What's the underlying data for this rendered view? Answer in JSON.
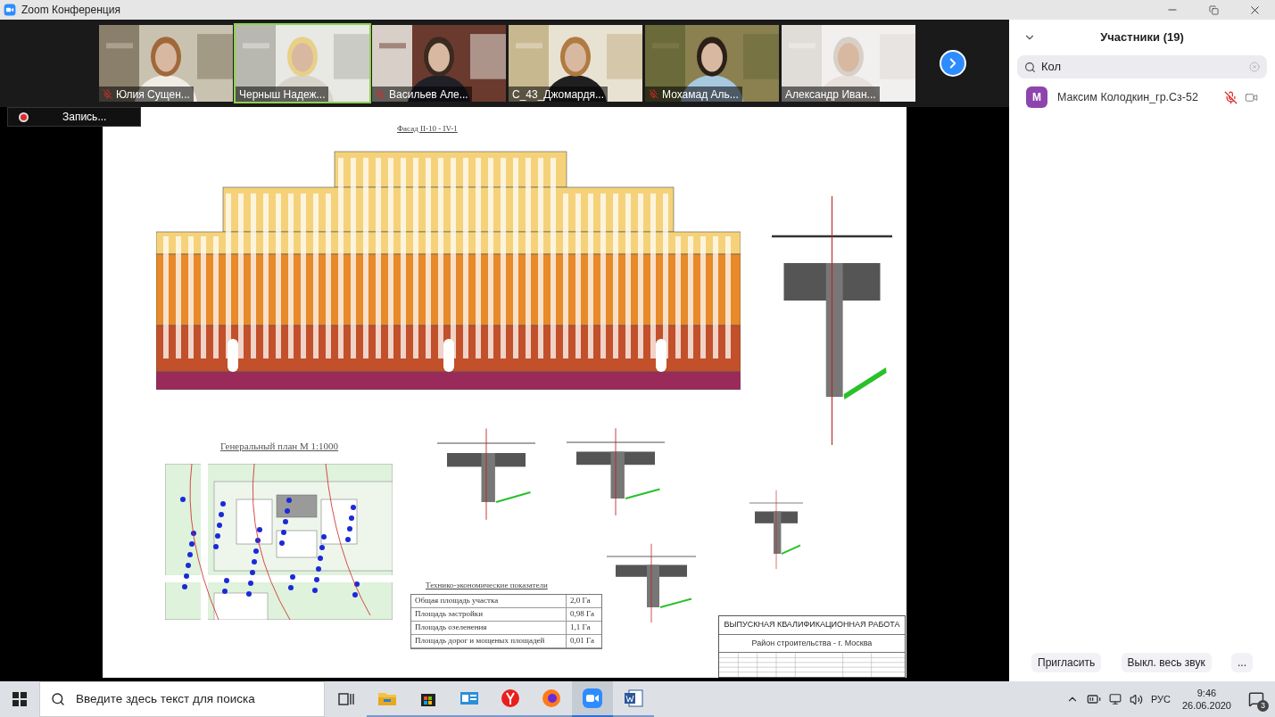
{
  "window": {
    "title": "Zoom Конференция"
  },
  "video_strip": {
    "tiles": [
      {
        "name": "Юлия Сущен...",
        "muted": true,
        "active_speaker": false
      },
      {
        "name": "Черныш Надеж...",
        "muted": false,
        "active_speaker": true
      },
      {
        "name": "Васильев Але...",
        "muted": true,
        "active_speaker": false
      },
      {
        "name": "С_43_Джомардя...",
        "muted": false,
        "active_speaker": false
      },
      {
        "name": "Мохамад Аль...",
        "muted": true,
        "active_speaker": false
      },
      {
        "name": "Александр Иван...",
        "muted": false,
        "active_speaker": false
      }
    ]
  },
  "recording": {
    "label": "Запись..."
  },
  "shared_sheet": {
    "facade_title": "Фасад II-10 - IV-1",
    "plan_title": "Генеральный план М 1:1000",
    "table_title": "Технико-экономические показатели",
    "table_rows": [
      {
        "label": "Общая площадь участка",
        "value": "2,0 Га"
      },
      {
        "label": "Площадь застройки",
        "value": "0,98 Га"
      },
      {
        "label": "Площадь озеленения",
        "value": "1,1 Га"
      },
      {
        "label": "Площадь дорог и мощеных площадей",
        "value": "0,01 Га"
      }
    ],
    "title_block": {
      "heading": "ВЫПУСКНАЯ КВАЛИФИКАЦИОННАЯ РАБОТА",
      "subheading": "Район строительства - г. Москва"
    }
  },
  "participants_panel": {
    "title": "Участники (19)",
    "search": {
      "value": "Кол"
    },
    "participants": [
      {
        "initial": "M",
        "name": "Максим Колодкин_гр.Сз-52",
        "color": "#8e44ad",
        "muted": true
      }
    ],
    "buttons": [
      "Пригласить",
      "Выкл. весь звук",
      "..."
    ]
  },
  "taskbar": {
    "search": {
      "placeholder": "Введите здесь текст для поиска"
    },
    "apps": [
      {
        "kind": "taskview",
        "selected": false
      },
      {
        "kind": "explorer",
        "selected": false
      },
      {
        "kind": "store",
        "selected": false
      },
      {
        "kind": "mail",
        "selected": false
      },
      {
        "kind": "yandex",
        "selected": false
      },
      {
        "kind": "firefox",
        "selected": false
      },
      {
        "kind": "zoom",
        "selected": true
      },
      {
        "kind": "word",
        "selected": false
      }
    ],
    "language": "РУС",
    "time": "9:46",
    "date": "26.06.2020",
    "notifications": "3"
  }
}
